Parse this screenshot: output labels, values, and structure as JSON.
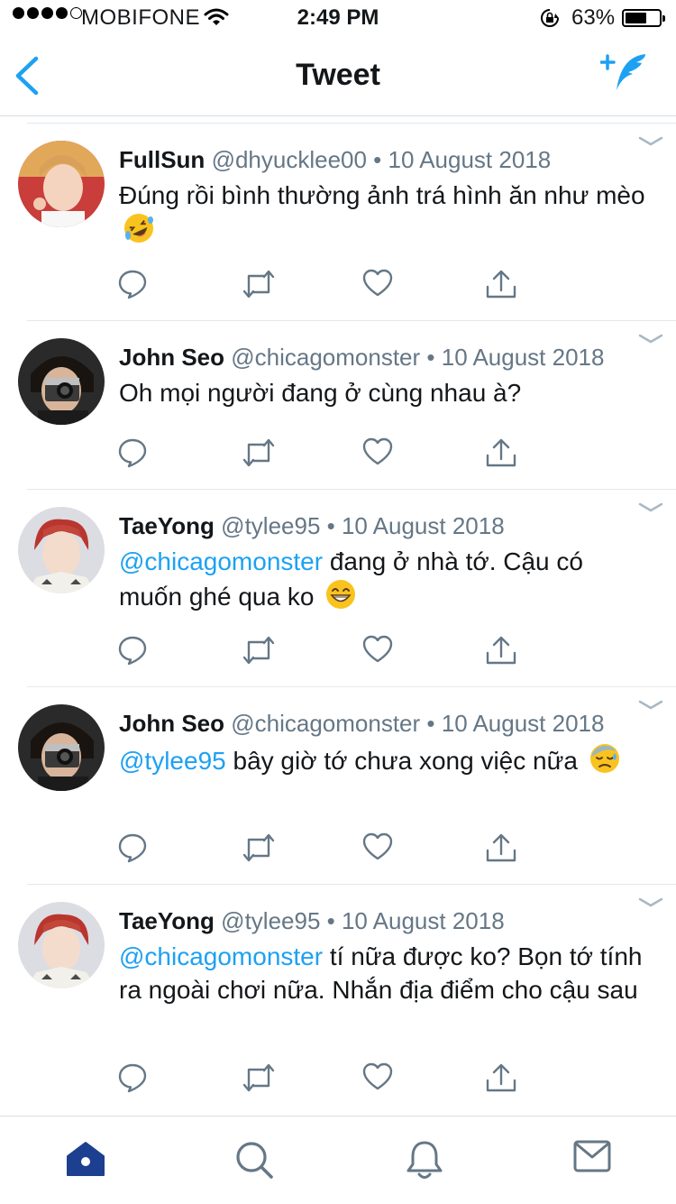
{
  "status_bar": {
    "carrier": "MOBIFONE",
    "time": "2:49 PM",
    "battery_percent": "63%",
    "battery_level": 0.63,
    "signal_bars": 4,
    "signal_total": 5
  },
  "nav": {
    "title": "Tweet",
    "back_icon": "chevron-left-icon",
    "compose_icon": "compose-tweet-icon"
  },
  "colors": {
    "accent": "#1da1f2",
    "text": "#14171a",
    "secondary": "#657786",
    "tab_active": "#1d3f8f"
  },
  "tweets": [
    {
      "name": "FullSun",
      "meta": "@dhyucklee00 • 10 August 2018",
      "mention": "",
      "text": "Đúng rồi bình thường ảnh trá hình ăn như mèo",
      "emoji": "rofl"
    },
    {
      "name": "John Seo",
      "meta": "@chicagomonster • 10 August 2018",
      "mention": "",
      "text": "Oh mọi người đang ở cùng nhau à?",
      "emoji": ""
    },
    {
      "name": "TaeYong",
      "meta": "@tylee95 • 10 August 2018",
      "mention": "@chicagomonster",
      "text": " đang ở nhà tớ. Cậu có muốn ghé qua ko",
      "emoji": "grin"
    },
    {
      "name": "John Seo",
      "meta": "@chicagomonster • 10 August 2018",
      "mention": "@tylee95",
      "text": " bây giờ tớ chưa xong việc nữa",
      "emoji": "sweat"
    },
    {
      "name": "TaeYong",
      "meta": "@tylee95 • 10 August 2018",
      "mention": "@chicagomonster",
      "text": " tí nữa được ko? Bọn tớ tính ra ngoài chơi nữa. Nhắn địa điểm cho cậu sau",
      "emoji": ""
    }
  ],
  "tab_bar": {
    "tabs": [
      "home-icon",
      "search-icon",
      "notifications-icon",
      "messages-icon"
    ],
    "active": "home-icon"
  }
}
